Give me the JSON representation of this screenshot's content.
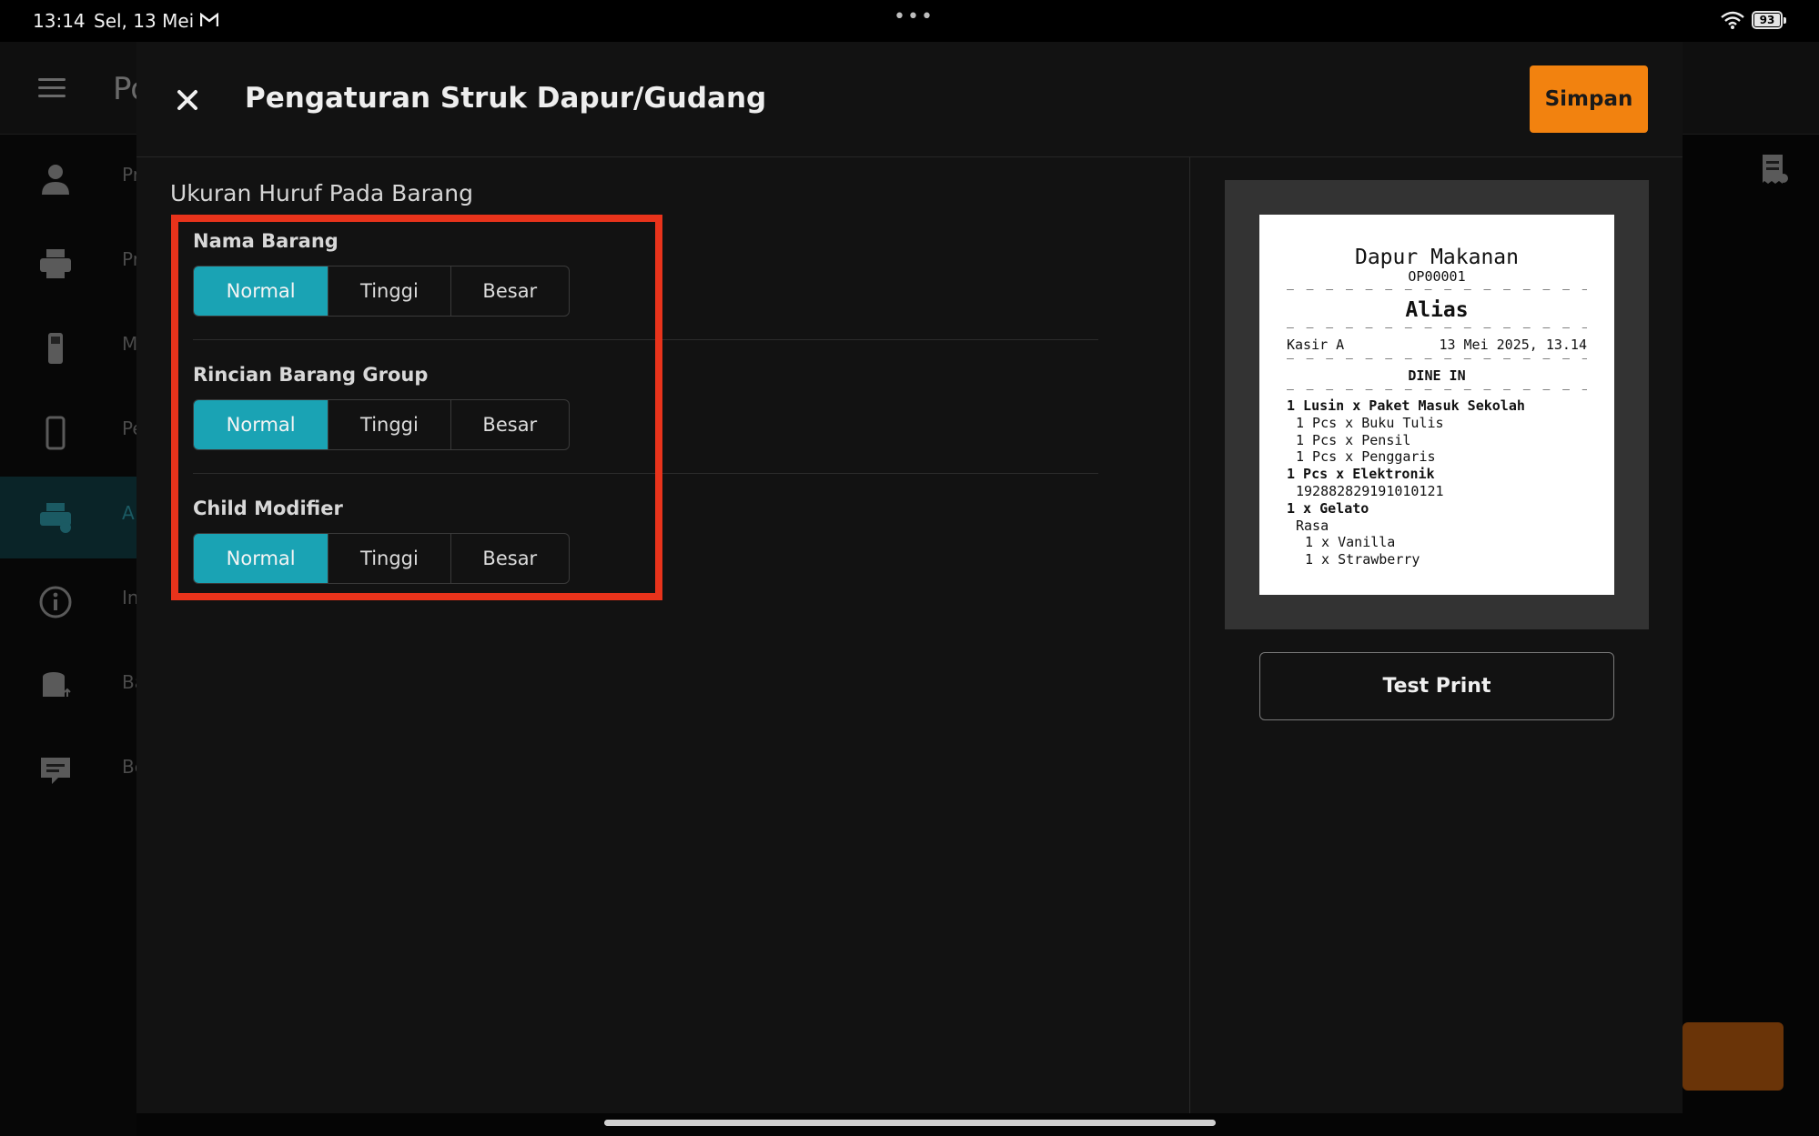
{
  "status_bar": {
    "time": "13:14",
    "date": "Sel, 13 Mei",
    "notification_icon": "gmail-icon",
    "dots": "•••",
    "battery": "93"
  },
  "background_app": {
    "title": "Po",
    "sidebar_labels": [
      "Pr",
      "Pr",
      "M",
      "Pe",
      "A",
      "In",
      "Ba",
      "Be"
    ]
  },
  "dialog": {
    "title": "Pengaturan Struk Dapur/Gudang",
    "save_label": "Simpan",
    "section_title": "Ukuran Huruf Pada Barang",
    "fields": [
      {
        "label": "Nama Barang",
        "options": [
          "Normal",
          "Tinggi",
          "Besar"
        ],
        "selected": "Normal"
      },
      {
        "label": "Rincian Barang Group",
        "options": [
          "Normal",
          "Tinggi",
          "Besar"
        ],
        "selected": "Normal"
      },
      {
        "label": "Child Modifier",
        "options": [
          "Normal",
          "Tinggi",
          "Besar"
        ],
        "selected": "Normal"
      }
    ],
    "test_print_label": "Test Print"
  },
  "receipt": {
    "title": "Dapur Makanan",
    "code": "OP00001",
    "alias": "Alias",
    "cashier": "Kasir A",
    "datetime": "13 Mei 2025, 13.14",
    "order_type": "DINE IN",
    "dashes": "— — — — — — — — — — — — — — — —",
    "lines": [
      "1 Lusin x Paket Masuk Sekolah",
      "1 Pcs x Buku Tulis",
      "1 Pcs x Pensil",
      "1 Pcs x Penggaris",
      "1 Pcs x Elektronik",
      "192882829191010121",
      "1 x Gelato",
      "Rasa",
      "1 x Vanilla",
      "1 x Strawberry"
    ]
  },
  "colors": {
    "accent_teal": "#1aa3b4",
    "save_orange": "#f2820f",
    "highlight_red": "#e8331b"
  }
}
